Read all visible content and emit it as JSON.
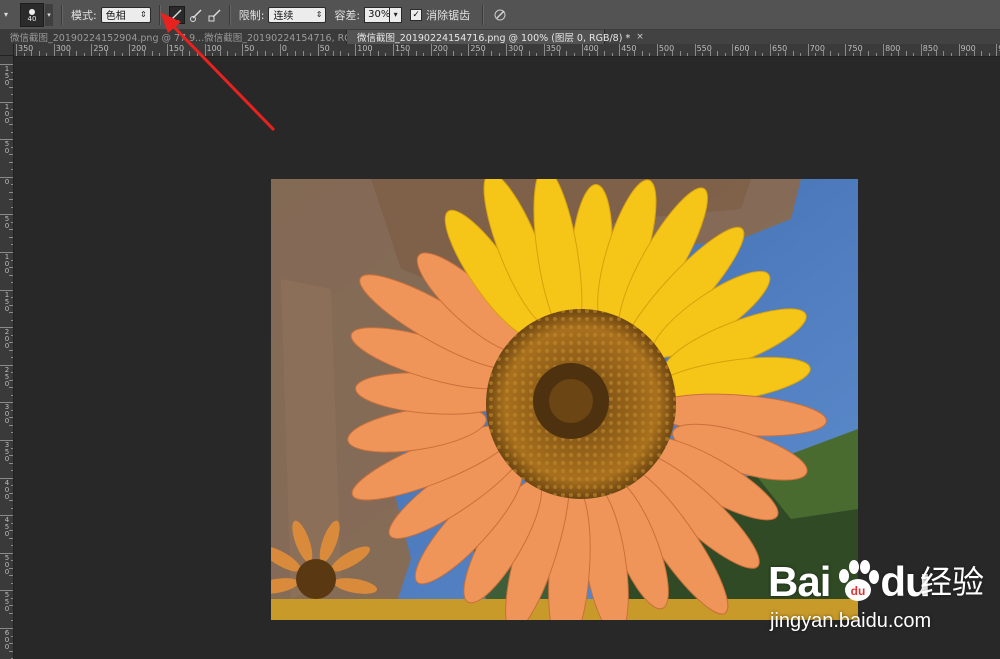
{
  "options_bar": {
    "brush_size": "40",
    "mode_label": "模式:",
    "mode_value": "色相",
    "limits_label": "限制:",
    "limits_value": "连续",
    "tolerance_label": "容差:",
    "tolerance_value": "30%",
    "antialias_checked": "✓",
    "antialias_label": "消除锯齿"
  },
  "tabs": [
    {
      "label": "微信截图_20190224152904.png @ 77.9...微信截图_20190224154716, RGB/8) *",
      "close": "×",
      "active": false
    },
    {
      "label": "微信截图_20190224154716.png @ 100% (图层 0, RGB/8) *",
      "close": "×",
      "active": true
    }
  ],
  "ruler_h_labels": [
    "350",
    "300",
    "250",
    "200",
    "150",
    "100",
    "50",
    "0",
    "50",
    "100",
    "150",
    "200",
    "250",
    "300",
    "350",
    "400",
    "450",
    "500",
    "550",
    "600",
    "650",
    "700",
    "750",
    "800",
    "850",
    "900",
    "950"
  ],
  "ruler_v_labels": [
    "150",
    "100",
    "50",
    "0",
    "50",
    "100",
    "150",
    "200",
    "250",
    "300",
    "350",
    "400",
    "450",
    "500",
    "550",
    "600"
  ],
  "watermark": {
    "logo": "Bai",
    "logo_tail": "du",
    "cn": "经验",
    "url": "jingyan.baidu.com"
  }
}
